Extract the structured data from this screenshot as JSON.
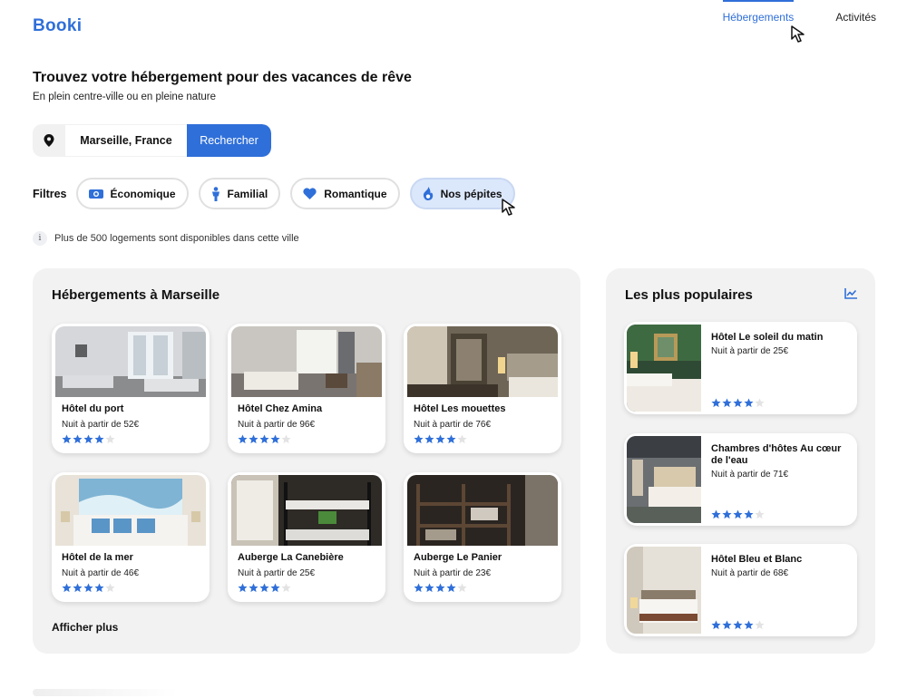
{
  "brand": {
    "name": "Booki"
  },
  "nav": {
    "items": [
      {
        "label": "Hébergements",
        "active": true
      },
      {
        "label": "Activités",
        "active": false
      }
    ]
  },
  "hero": {
    "title": "Trouvez votre hébergement pour des vacances de rêve",
    "subtitle": "En plein centre-ville ou en pleine nature"
  },
  "search": {
    "icon": "location-pin-icon",
    "city": "Marseille, France",
    "button_label": "Rechercher"
  },
  "filters": {
    "label": "Filtres",
    "chips": [
      {
        "label": "Économique",
        "icon": "money-icon",
        "active": false
      },
      {
        "label": "Familial",
        "icon": "person-icon",
        "active": false
      },
      {
        "label": "Romantique",
        "icon": "heart-icon",
        "active": false
      },
      {
        "label": "Nos pépites",
        "icon": "fire-icon",
        "active": true
      }
    ]
  },
  "info": {
    "icon": "info-icon",
    "text": "Plus de 500 logements sont disponibles dans cette ville"
  },
  "accommodations": {
    "title": "Hébergements à Marseille",
    "more_label": "Afficher plus",
    "items": [
      {
        "name": "Hôtel du port",
        "price": "Nuit à partir de 52€",
        "rating": 4,
        "max_rating": 5
      },
      {
        "name": "Hôtel Chez Amina",
        "price": "Nuit à partir de 96€",
        "rating": 4,
        "max_rating": 5
      },
      {
        "name": "Hôtel Les mouettes",
        "price": "Nuit à partir de 76€",
        "rating": 4,
        "max_rating": 5
      },
      {
        "name": "Hôtel de la mer",
        "price": "Nuit à partir de 46€",
        "rating": 4,
        "max_rating": 5
      },
      {
        "name": "Auberge La Canebière",
        "price": "Nuit à partir de 25€",
        "rating": 4,
        "max_rating": 5
      },
      {
        "name": "Auberge Le Panier",
        "price": "Nuit à partir de 23€",
        "rating": 4,
        "max_rating": 5
      }
    ]
  },
  "popular": {
    "title": "Les plus populaires",
    "icon": "trend-chart-icon",
    "items": [
      {
        "name": "Hôtel Le soleil du matin",
        "price": "Nuit à partir de 25€",
        "rating": 4,
        "max_rating": 5
      },
      {
        "name": "Chambres d'hôtes Au cœur de l'eau",
        "price": "Nuit à partir de 71€",
        "rating": 4,
        "max_rating": 5
      },
      {
        "name": "Hôtel Bleu et Blanc",
        "price": "Nuit à partir de 68€",
        "rating": 4,
        "max_rating": 5
      }
    ]
  },
  "colors": {
    "accent": "#2f6fd9",
    "panel": "#f2f2f2",
    "chip_active": "#dbe7fb",
    "star_off": "#e3e3e3"
  }
}
